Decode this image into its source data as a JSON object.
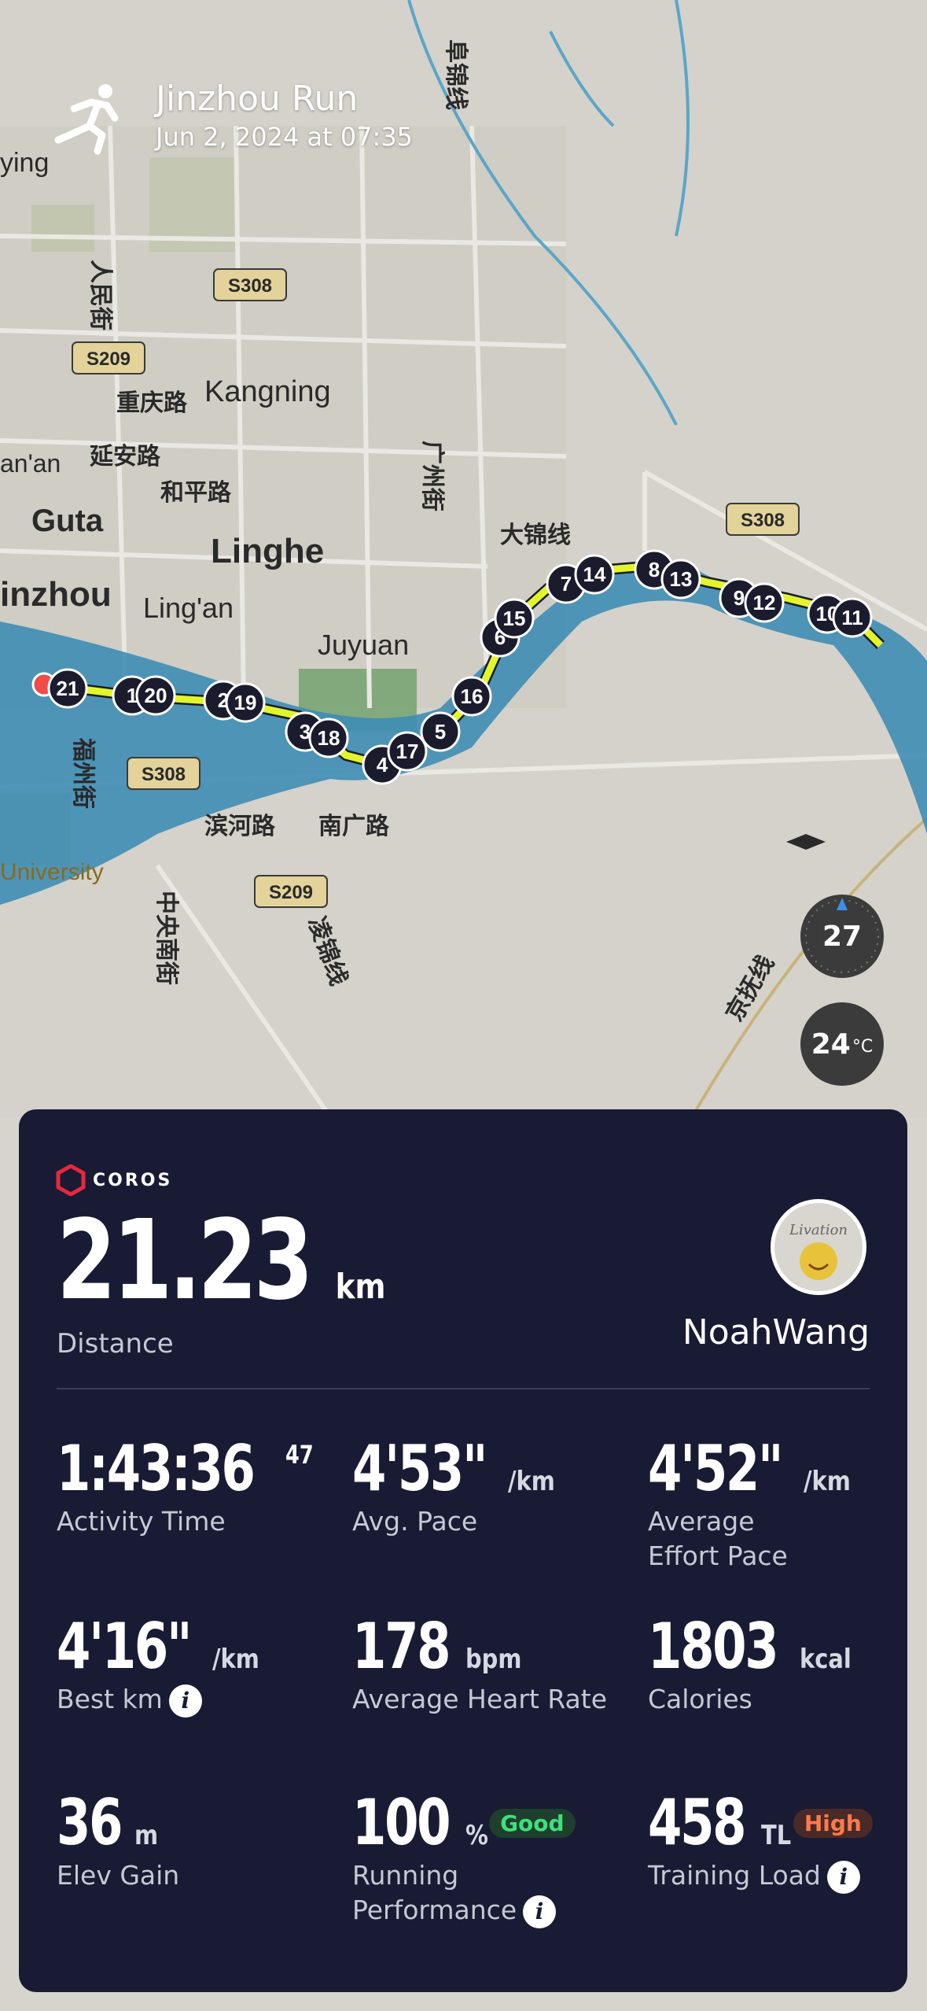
{
  "header": {
    "title": "Jinzhou Run",
    "date": "Jun 2, 2024 at 07:35"
  },
  "map": {
    "labels": {
      "kangning": "Kangning",
      "guta": "Guta",
      "linghe": "Linghe",
      "jinzhou": "inzhou",
      "lingan": "Ling'an",
      "juyuan": "Juyuan",
      "ying": "ying",
      "nan": "an'an",
      "university": "University",
      "chongqing": "重庆路",
      "yanan": "延安路",
      "heping": "和平路",
      "renmin": "人民街",
      "guangzhou": "广州街",
      "dajin": "大锦线",
      "fujin": "阜锦线",
      "fuzhou": "福州街",
      "binhe": "滨河路",
      "nanguang": "南广路",
      "zhongyang": "中央南街",
      "hanjin": "凌锦线",
      "jingfu": "京抚线"
    },
    "road_shields": [
      "S308",
      "S209",
      "S308",
      "S308",
      "S209"
    ],
    "markers": [
      "21",
      "1",
      "20",
      "2",
      "19",
      "3",
      "18",
      "4",
      "17",
      "5",
      "16",
      "6",
      "15",
      "7",
      "14",
      "8",
      "13",
      "9",
      "12",
      "10",
      "11"
    ],
    "compass_value": "27",
    "temperature": "24",
    "temperature_unit": "°C"
  },
  "card": {
    "brand": "COROS",
    "distance": {
      "value": "21.23",
      "unit": "km",
      "label": "Distance"
    },
    "user": {
      "name": "NoahWang",
      "avatar_text": "Livation"
    },
    "stats": {
      "activity_time": {
        "value": "1:43:36",
        "sup": "47",
        "label": "Activity Time"
      },
      "avg_pace": {
        "value": "4'53\"",
        "unit": "/km",
        "label": "Avg. Pace"
      },
      "effort_pace": {
        "value": "4'52\"",
        "unit": "/km",
        "label1": "Average",
        "label2": "Effort Pace"
      },
      "best_km": {
        "value": "4'16\"",
        "unit": "/km",
        "label": "Best km"
      },
      "avg_hr": {
        "value": "178",
        "unit": "bpm",
        "label": "Average Heart Rate"
      },
      "calories": {
        "value": "1803",
        "unit": "kcal",
        "label": "Calories"
      },
      "elev_gain": {
        "value": "36",
        "unit": "m",
        "label": "Elev Gain"
      },
      "running_perf": {
        "value": "100",
        "unit": "%",
        "badge": "Good",
        "label1": "Running",
        "label2": "Performance"
      },
      "training_load": {
        "value": "458",
        "unit": "TL",
        "badge": "High",
        "label": "Training Load"
      }
    },
    "colors": {
      "background": "#181b33",
      "route": "#e2f52a",
      "good": "#3ee07a",
      "high": "#ff7a4a"
    }
  }
}
